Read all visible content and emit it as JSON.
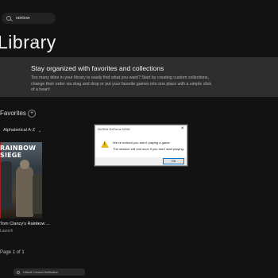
{
  "search": {
    "value": "rainbow",
    "icon": "search-icon"
  },
  "library": {
    "title": "Library",
    "icon": "collection-icon"
  },
  "banner": {
    "title": "Stay organized with favorites and collections",
    "body": "Too many titles in your library to easily find what you want? Start by creating custom collections, change their order via drag and drop or put your favorite games into one place with a simple click of a heart!"
  },
  "favorites": {
    "label": "Favorites",
    "add_icon": "plus-icon"
  },
  "sort": {
    "label": "Alphabetical A-Z",
    "icon": "chevron-down-icon"
  },
  "game_card": {
    "logo_text": "RAINBOW SIEGE",
    "title": "Tom Clancy's Rainbow ...",
    "more_label": "...",
    "subtitle": "Launch"
  },
  "pager": {
    "text": "Page 1 of 1"
  },
  "toast": {
    "text": "Ubisoft Connect Notification"
  },
  "dialog": {
    "title": "NVIDIA GeForce NOW",
    "message_line1": "We've noticed you aren't playing a game.",
    "message_line2": "The session will end soon if you don't start playing.",
    "ok_label": "OK",
    "close_label": "✕",
    "icon": "warning-icon"
  },
  "colors": {
    "background": "#121212",
    "banner": "#2e2e2e",
    "dialog_accent": "#0078d7",
    "warning": "#e8b81d"
  }
}
